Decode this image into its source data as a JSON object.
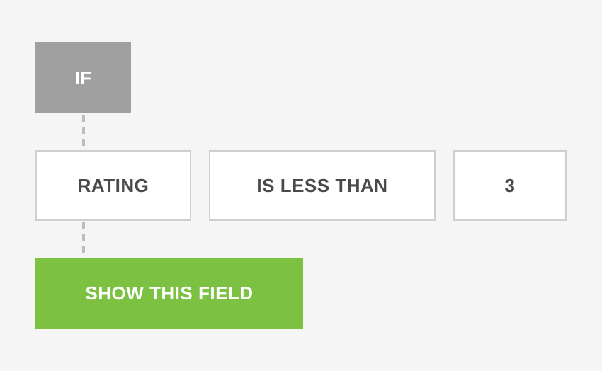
{
  "condition": {
    "keyword": "IF",
    "field": "RATING",
    "operator": "IS LESS THAN",
    "value": "3"
  },
  "action": {
    "label": "SHOW THIS FIELD"
  }
}
